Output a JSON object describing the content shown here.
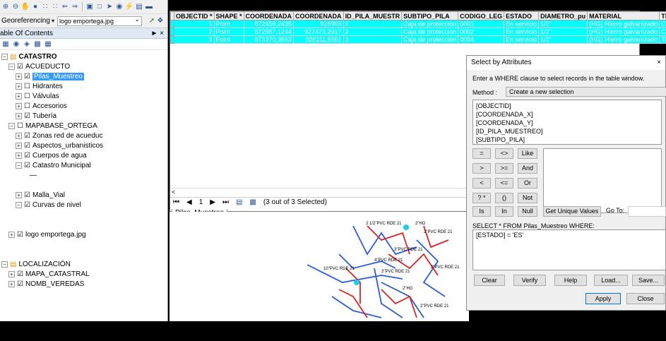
{
  "toolbar": {
    "georef_label": "Georeferencing",
    "georef_value": "logo emportega.jpg"
  },
  "toc": {
    "title": "able Of Contents",
    "pin": "਀ ×"
  },
  "tree": [
    {
      "label": "CATASTRO",
      "indent": 0,
      "exp": "−",
      "chk": "",
      "group": true,
      "bold": true
    },
    {
      "label": "ACUEDUCTO",
      "indent": 1,
      "exp": "−",
      "chk": "☑"
    },
    {
      "label": "Pilas_Muestreo",
      "indent": 2,
      "exp": "+",
      "chk": "☑",
      "selected": true
    },
    {
      "label": "Hidrantes",
      "indent": 2,
      "exp": "+",
      "chk": "☐"
    },
    {
      "label": "Válvulas",
      "indent": 2,
      "exp": "+",
      "chk": "☐"
    },
    {
      "label": "Accesorios",
      "indent": 2,
      "exp": "+",
      "chk": "☐"
    },
    {
      "label": "Tubería",
      "indent": 2,
      "exp": "+",
      "chk": "☑"
    },
    {
      "label": "MAPABASE_ORTEGA",
      "indent": 1,
      "exp": "−",
      "chk": "☐"
    },
    {
      "label": "Zonas red de acueduc",
      "indent": 2,
      "exp": "+",
      "chk": "☑"
    },
    {
      "label": "Aspectos_urbanisticos",
      "indent": 2,
      "exp": "+",
      "chk": "☑"
    },
    {
      "label": "Cuerpos de agua",
      "indent": 2,
      "exp": "+",
      "chk": "☑"
    },
    {
      "label": "Catastro Municipal",
      "indent": 2,
      "exp": "−",
      "chk": "☑"
    },
    {
      "label": "—",
      "indent": 4,
      "exp": "",
      "chk": ""
    },
    {
      "label": "",
      "indent": 0,
      "exp": "",
      "chk": ""
    },
    {
      "label": "Malla_Vial",
      "indent": 2,
      "exp": "+",
      "chk": "☑"
    },
    {
      "label": "Curvas de nivel",
      "indent": 2,
      "exp": "−",
      "chk": "☑"
    },
    {
      "label": "",
      "indent": 0,
      "exp": "",
      "chk": ""
    },
    {
      "label": "",
      "indent": 0,
      "exp": "",
      "chk": ""
    },
    {
      "label": "logo emportega.jpg",
      "indent": 1,
      "exp": "+",
      "chk": "☑"
    },
    {
      "label": "",
      "indent": 0,
      "exp": "",
      "chk": ""
    },
    {
      "label": "",
      "indent": 0,
      "exp": "",
      "chk": ""
    },
    {
      "label": "LOCALIZACIÓN",
      "indent": 0,
      "exp": "−",
      "chk": "",
      "group": true
    },
    {
      "label": "MAPA_CATASTRAL",
      "indent": 1,
      "exp": "+",
      "chk": "☑"
    },
    {
      "label": "NOMB_VEREDAS",
      "indent": 1,
      "exp": "+",
      "chk": "☑"
    }
  ],
  "table": {
    "columns": [
      "OBJECTID *",
      "SHAPE *",
      "COORDENADA",
      "COORDENADA",
      "ID_PILA_MUESTR",
      "SUBTIPO_PILA",
      "CODIGO_LEG",
      "ESTADO",
      "DIAMETRO_pu",
      "MATERIAL",
      "TERRENO"
    ],
    "rows": [
      [
        "1",
        "Point",
        "872459,2435",
        "926903",
        "1",
        "Caja de protección",
        "0001",
        "En servicio",
        "1/2\"",
        "(HG) Hierro galvanizado",
        "Concreto"
      ],
      [
        "2",
        "Point",
        "872987,1244",
        "927473,2917",
        "2",
        "Caja de protección",
        "0002",
        "En servicio",
        "1/2\"",
        "(HG) Hierro galvanizado",
        "Concreto"
      ],
      [
        "3",
        "Point",
        "873370,3663",
        "926111,6661",
        "3",
        "Caja de protección",
        "0004",
        "En servicio",
        "1/2\"",
        "(HG) Hierro galvanizado",
        "Tierra"
      ]
    ],
    "nav_current": "1",
    "nav_status": "(3 out of 3 Selected)",
    "tab": "Pilas_Muestreo"
  },
  "map": {
    "labels": [
      "2 1/2\"PVC RDE 21",
      "2\"HG",
      "2\"PVC RDE 21",
      "3\"PVC RDE 21",
      "4\"PVC RDE 21",
      "10\"PVC RDE 21",
      "2\"PVC RDE 21",
      "2\"PVC RDE 21",
      "2\"HG",
      "2\"PVC RDE 21"
    ]
  },
  "dialog": {
    "title": "Select by Attributes",
    "close": "×",
    "instruction": "Enter a WHERE clause to select records in the table window.",
    "method_label": "Method :",
    "method_value": "Create a new selection",
    "fields": [
      "[OBJECTID]",
      "[COORDENADA_X]",
      "[COORDENADA_Y]",
      "[ID_PILA_MUESTREO]",
      "[SUBTIPO_PILA]",
      "[CODIGO_LEGAL]"
    ],
    "ops": [
      "=",
      "<>",
      "Like",
      ">",
      ">=",
      "And",
      "<",
      "<=",
      "Or",
      "? *",
      "()",
      "Not"
    ],
    "is": "Is",
    "in": "In",
    "null": "Null",
    "get_unique": "Get Unique Values",
    "goto": "Go To:",
    "sql_header": "SELECT * FROM Pilas_Muestreo WHERE:",
    "sql": "[ESTADO] = 'ES'",
    "clear": "Clear",
    "verify": "Verify",
    "help": "Help",
    "load": "Load...",
    "save": "Save...",
    "apply": "Apply",
    "close_btn": "Close"
  }
}
